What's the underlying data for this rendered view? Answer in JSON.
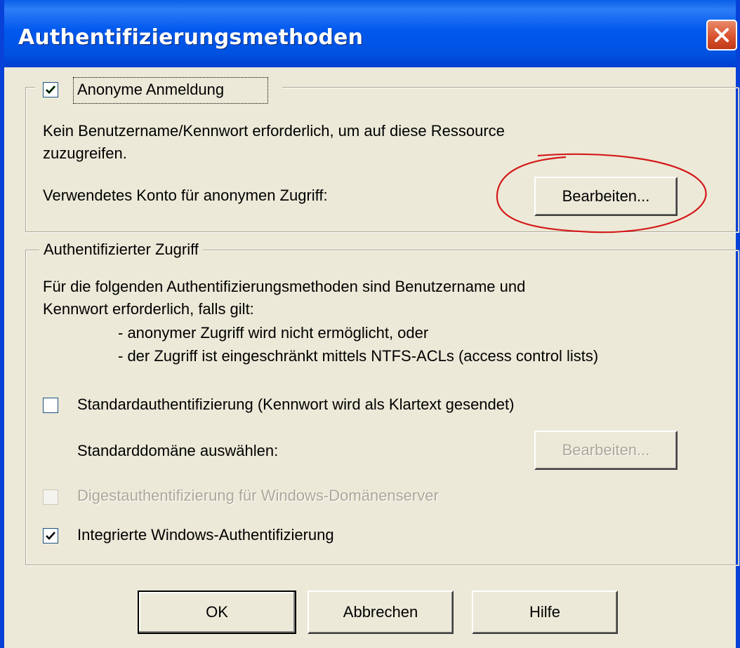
{
  "window": {
    "title": "Authentifizierungsmethoden",
    "close_icon": "close-icon"
  },
  "anonymous": {
    "checkbox_label": "Anonyme Anmeldung",
    "checked": true,
    "description_line1": "Kein Benutzername/Kennwort erforderlich, um auf diese Ressource",
    "description_line2": "zuzugreifen.",
    "account_label": "Verwendetes Konto für anonymen Zugriff:",
    "edit_button": "Bearbeiten..."
  },
  "authenticated": {
    "group_label": "Authentifizierter Zugriff",
    "description_line1": "Für die folgenden Authentifizierungsmethoden sind Benutzername und",
    "description_line2": "Kennwort erforderlich, falls gilt:",
    "bullet1": "- anonymer Zugriff wird nicht ermöglicht, oder",
    "bullet2": "- der Zugriff ist eingeschränkt mittels NTFS-ACLs (access control lists)",
    "basic_auth_label": "Standardauthentifizierung (Kennwort wird als Klartext gesendet)",
    "basic_auth_checked": false,
    "default_domain_label": "Standarddomäne auswählen:",
    "default_domain_button": "Bearbeiten...",
    "digest_auth_label": "Digestauthentifizierung für Windows-Domänenserver",
    "digest_auth_checked": false,
    "integrated_auth_label": "Integrierte Windows-Authentifizierung",
    "integrated_auth_checked": true
  },
  "buttons": {
    "ok": "OK",
    "cancel": "Abbrechen",
    "help": "Hilfe"
  },
  "colors": {
    "title_bar": "#0058ee",
    "dialog_bg": "#ece9d8",
    "annotation": "#d41a1a"
  }
}
